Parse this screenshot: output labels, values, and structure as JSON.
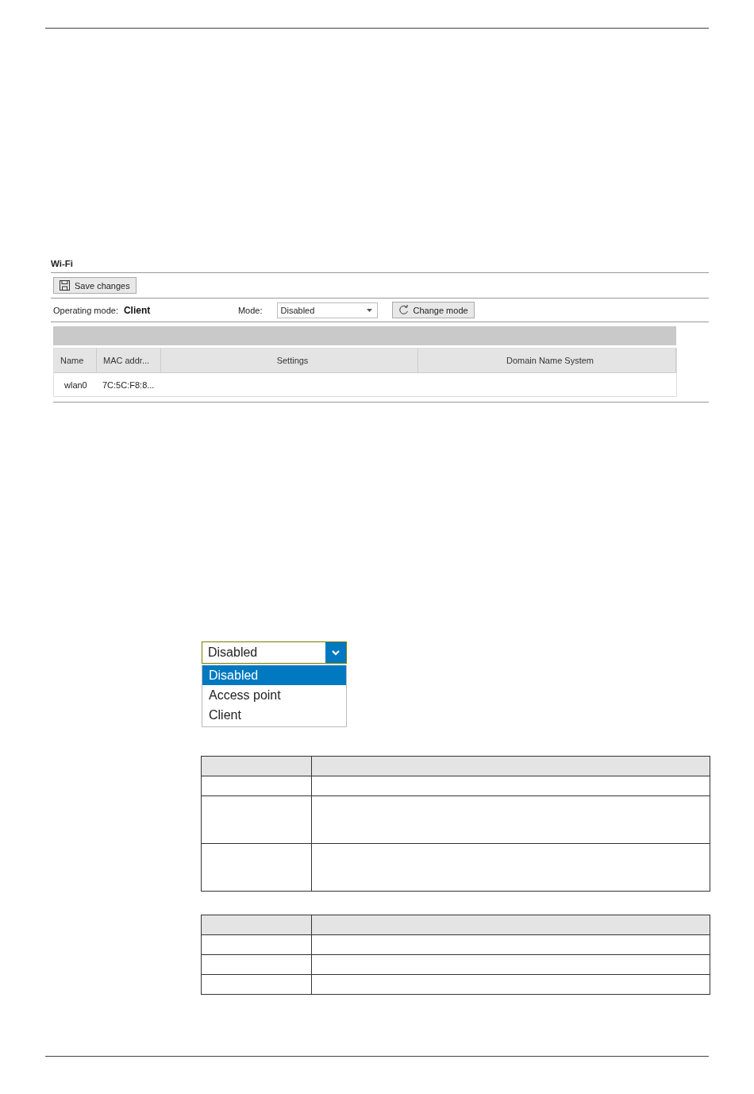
{
  "panel": {
    "title": "Wi-Fi",
    "save_button": "Save changes",
    "operating_mode_label": "Operating mode:",
    "operating_mode_value": "Client",
    "mode_label": "Mode:",
    "mode_value": "Disabled",
    "change_button": "Change mode",
    "table": {
      "columns": [
        "Name",
        "MAC addr...",
        "Settings",
        "Domain Name System"
      ],
      "rows": [
        [
          "wlan0",
          "7C:5C:F8:8...",
          "",
          ""
        ]
      ]
    }
  },
  "dropdown": {
    "value": "Disabled",
    "options": [
      {
        "label": "Disabled",
        "selected": true
      },
      {
        "label": "Access point",
        "selected": false
      },
      {
        "label": "Client",
        "selected": false
      }
    ]
  },
  "doc_tables": [
    {
      "rows": [
        {
          "kind": "short"
        },
        {
          "kind": "tall"
        },
        {
          "kind": "tall"
        }
      ]
    },
    {
      "rows": [
        {
          "kind": "short"
        },
        {
          "kind": "short"
        },
        {
          "kind": "short"
        }
      ]
    }
  ]
}
